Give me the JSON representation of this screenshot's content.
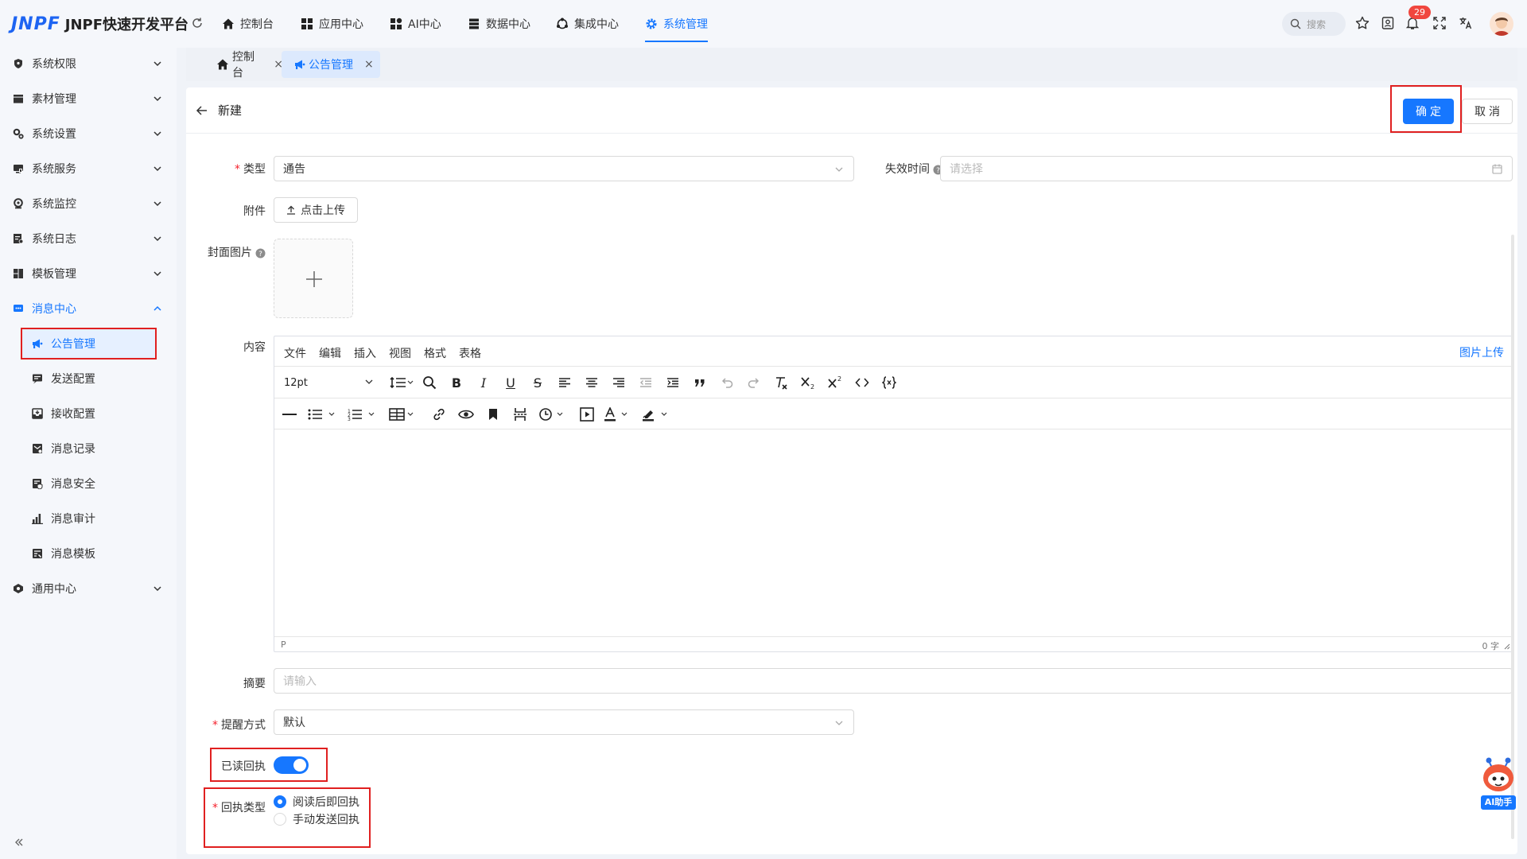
{
  "app": {
    "logo_mark": "JNPF",
    "logo_text": "JNPF快速开发平台"
  },
  "top_nav": [
    {
      "label": "控制台",
      "icon": "home-icon"
    },
    {
      "label": "应用中心",
      "icon": "apps-icon"
    },
    {
      "label": "AI中心",
      "icon": "ai-grid-icon"
    },
    {
      "label": "数据中心",
      "icon": "database-icon"
    },
    {
      "label": "集成中心",
      "icon": "integration-icon"
    },
    {
      "label": "系统管理",
      "icon": "gear-icon",
      "active": true
    }
  ],
  "toolbar": {
    "search_placeholder": "搜索",
    "notification_count": "29"
  },
  "sidebar": {
    "items": [
      {
        "label": "系统权限",
        "icon": "shield-icon"
      },
      {
        "label": "素材管理",
        "icon": "folder-icon"
      },
      {
        "label": "系统设置",
        "icon": "settings-icon"
      },
      {
        "label": "系统服务",
        "icon": "server-icon"
      },
      {
        "label": "系统监控",
        "icon": "monitor-icon"
      },
      {
        "label": "系统日志",
        "icon": "log-icon"
      },
      {
        "label": "模板管理",
        "icon": "template-icon"
      },
      {
        "label": "消息中心",
        "icon": "message-icon",
        "open": true
      }
    ],
    "sub_items": [
      {
        "label": "公告管理",
        "icon": "megaphone-icon",
        "active": true
      },
      {
        "label": "发送配置",
        "icon": "send-config-icon"
      },
      {
        "label": "接收配置",
        "icon": "inbox-icon"
      },
      {
        "label": "消息记录",
        "icon": "mail-record-icon"
      },
      {
        "label": "消息安全",
        "icon": "security-icon"
      },
      {
        "label": "消息审计",
        "icon": "bar-chart-icon"
      },
      {
        "label": "消息模板",
        "icon": "template-doc-icon"
      }
    ],
    "last_item": {
      "label": "通用中心",
      "icon": "hub-icon"
    }
  },
  "tabs": [
    {
      "label": "控制台",
      "close": "×"
    },
    {
      "label": "公告管理",
      "close": "×",
      "active": true
    }
  ],
  "form": {
    "title": "新建",
    "confirm_label": "确定",
    "cancel_label": "取消",
    "type_label": "类型",
    "type_value": "通告",
    "expire_label": "失效时间",
    "expire_placeholder": "请选择",
    "attachment_label": "附件",
    "upload_label": "点击上传",
    "cover_label": "封面图片",
    "content_label": "内容",
    "summary_label": "摘要",
    "summary_placeholder": "请输入",
    "remind_label": "提醒方式",
    "remind_value": "默认",
    "read_receipt_label": "已读回执",
    "read_receipt_on": true,
    "receipt_type_label": "回执类型",
    "receipt_options": [
      {
        "label": "阅读后即回执",
        "checked": true
      },
      {
        "label": "手动发送回执",
        "checked": false
      }
    ]
  },
  "editor": {
    "menus": [
      "文件",
      "编辑",
      "插入",
      "视图",
      "格式",
      "表格"
    ],
    "image_upload_label": "图片上传",
    "font_size": "12pt",
    "status_path": "P",
    "word_count": "0 字"
  },
  "ai": {
    "label": "AI助手"
  },
  "colors": {
    "accent": "#1677ff",
    "highlight_box": "#e02020",
    "badge": "#f0463e"
  }
}
